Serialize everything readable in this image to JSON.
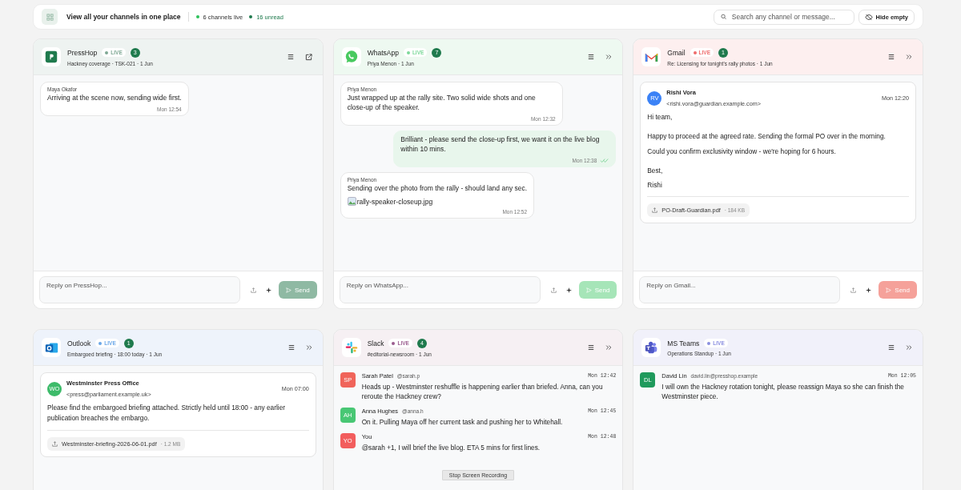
{
  "topbar": {
    "title": "View all your channels in one place",
    "live": "6 channels live",
    "unread": "16 unread",
    "search": {
      "placeholder": "Search any channel or message..."
    },
    "hide_button": "Hide empty"
  },
  "panels": [
    {
      "name": "PressHop",
      "live": {
        "label": "LIVE",
        "color": "#7fa894"
      },
      "count": "3",
      "subtitle": "Hackney coverage · TSK-021 · 1 Jun",
      "color": "#eef3f1",
      "actions": [
        {
          "kind": "menu"
        },
        {
          "kind": "open"
        }
      ],
      "kind": "chat",
      "messages": [
        {
          "author": "Maya Okafor",
          "text": "Arriving at the scene now, sending wide first.",
          "time": "Mon 12:54",
          "outgoing": false
        }
      ],
      "composer": {
        "placeholder": "Reply on PressHop...",
        "send": {
          "label": "Send",
          "color": "#8fb9a3"
        }
      }
    },
    {
      "name": "WhatsApp",
      "live": {
        "label": "LIVE",
        "color": "#7ed99a"
      },
      "count": "7",
      "subtitle": "Priya Menon · 1 Jun",
      "color": "#eef9f1",
      "actions": [
        {
          "kind": "menu"
        },
        {
          "kind": "expand"
        }
      ],
      "kind": "chat",
      "messages": [
        {
          "author": "Priya Menon",
          "text": "Just wrapped up at the rally site. Two solid wide shots and one close-up of the speaker.",
          "time": "Mon 12:32",
          "outgoing": false
        },
        {
          "text": "Brilliant - please send the close-up first, we want it on the live blog within 10 mins.",
          "time": "Mon 12:38",
          "outgoing": true,
          "read": true
        },
        {
          "author": "Priya Menon",
          "text": "Sending over the photo from the rally - should land any sec.",
          "attachment": "rally-speaker-closeup.jpg",
          "time": "Mon 12:52",
          "outgoing": false
        }
      ],
      "composer": {
        "placeholder": "Reply on WhatsApp...",
        "send": {
          "label": "Send",
          "color": "#a6e5b8"
        }
      }
    },
    {
      "name": "Gmail",
      "live": {
        "label": "LIVE",
        "color": "#ef6b6b"
      },
      "count": "1",
      "subtitle": "Re: Licensing for tonight's rally photos · 1 Jun",
      "color": "#fdefef",
      "actions": [
        {
          "kind": "menu"
        },
        {
          "kind": "expand"
        }
      ],
      "kind": "email",
      "email": {
        "avatar": {
          "initials": "RV",
          "color": "#3b82f6"
        },
        "from": "Rishi Vora",
        "address": "<rishi.vora@guardian.example.com>",
        "time": "Mon 12:20",
        "paragraphs": [
          [
            "Hi team,"
          ],
          [
            "Happy to proceed at the agreed rate. Sending the formal PO over in the morning.",
            "Could you confirm exclusivity window - we're hoping for 6 hours."
          ],
          [
            "Best,",
            "Rishi"
          ]
        ],
        "attachment": {
          "name": "PO-Draft-Guardian.pdf",
          "size": "· 184 KB"
        }
      },
      "composer": {
        "placeholder": "Reply on Gmail...",
        "send": {
          "label": "Send",
          "color": "#f5a19a"
        }
      }
    },
    {
      "name": "Outlook",
      "live": {
        "label": "LIVE",
        "color": "#6aa7e8"
      },
      "count": "1",
      "subtitle": "Embargoed briefing · 18:00 today · 1 Jun",
      "color": "#eef3fb",
      "actions": [
        {
          "kind": "menu"
        },
        {
          "kind": "expand"
        }
      ],
      "kind": "email",
      "email": {
        "avatar": {
          "initials": "WO",
          "color": "#3dbb6a"
        },
        "from": "Westminster Press Office",
        "address": "<press@parliament.example.uk>",
        "time": "Mon 07:00",
        "paragraphs": [
          [
            "Please find the embargoed briefing attached. Strictly held until 18:00 - any earlier publication breaches the embargo."
          ]
        ],
        "attachment": {
          "name": "Westminster-briefing-2026-06-01.pdf",
          "size": "· 1.2 MB"
        }
      }
    },
    {
      "name": "Slack",
      "live": {
        "label": "LIVE",
        "color": "#9b5c8f"
      },
      "count": "4",
      "subtitle": "#editorial-newsroom · 1 Jun",
      "color": "#f6f0f3",
      "actions": [
        {
          "kind": "menu"
        },
        {
          "kind": "expand"
        }
      ],
      "kind": "thread",
      "posts": [
        {
          "initials": "SP",
          "color": "#f0645a",
          "name": "Sarah Patel",
          "handle": "@sarah.p",
          "time": "Mon 12:42",
          "text": "Heads up - Westminster reshuffle is happening earlier than briefed. Anna, can you reroute the Hackney crew?"
        },
        {
          "initials": "AH",
          "color": "#48c774",
          "name": "Anna Hughes",
          "handle": "@anna.h",
          "time": "Mon 12:45",
          "text": "On it. Pulling Maya off her current task and pushing her to Whitehall."
        },
        {
          "initials": "YO",
          "color": "#f25d5d",
          "name": "You",
          "time": "Mon 12:48",
          "text": "@sarah +1, I will brief the live blog. ETA 5 mins for first lines."
        }
      ],
      "overlay_button": "Stop Screen Recording"
    },
    {
      "name": "MS Teams",
      "live": {
        "label": "LIVE",
        "color": "#8b8fe0"
      },
      "subtitle": "Operations Standup · 1 Jun",
      "color": "#f1f1fa",
      "actions": [
        {
          "kind": "menu"
        },
        {
          "kind": "expand"
        }
      ],
      "kind": "thread",
      "posts": [
        {
          "initials": "DL",
          "color": "#1f9a5c",
          "name": "David Lin",
          "handle": "david.lin@presshop.example",
          "time": "Mon 12:05",
          "text": "I will own the Hackney rotation tonight, please reassign Maya so she can finish the Westminster piece."
        }
      ]
    }
  ]
}
